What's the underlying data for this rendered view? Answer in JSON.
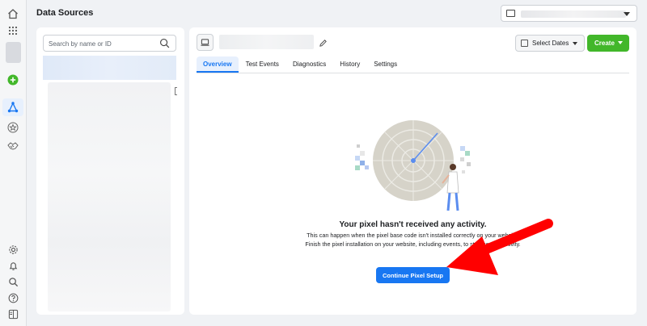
{
  "header": {
    "title": "Data Sources"
  },
  "search": {
    "placeholder": "Search by name or ID"
  },
  "toolbar": {
    "select_dates_label": "Select Dates",
    "create_label": "Create"
  },
  "tabs": [
    {
      "label": "Overview",
      "active": true
    },
    {
      "label": "Test Events"
    },
    {
      "label": "Diagnostics"
    },
    {
      "label": "History"
    },
    {
      "label": "Settings"
    }
  ],
  "empty_state": {
    "title": "Your pixel hasn't received any activity.",
    "description": "This can happen when the pixel base code isn't installed correctly on your website. Finish the pixel installation on your website, including events, to start seeing activity.",
    "button_label": "Continue Pixel Setup"
  },
  "colors": {
    "primary": "#1877f2",
    "create_green": "#42b72a",
    "annotation_red": "#ff0000"
  },
  "icons": [
    "home-icon",
    "apps-grid-icon",
    "add-icon",
    "data-sources-icon",
    "star-icon",
    "handshake-icon",
    "settings-icon",
    "bell-icon",
    "search-icon",
    "help-icon",
    "panel-icon",
    "pencil-icon",
    "calendar-icon"
  ]
}
